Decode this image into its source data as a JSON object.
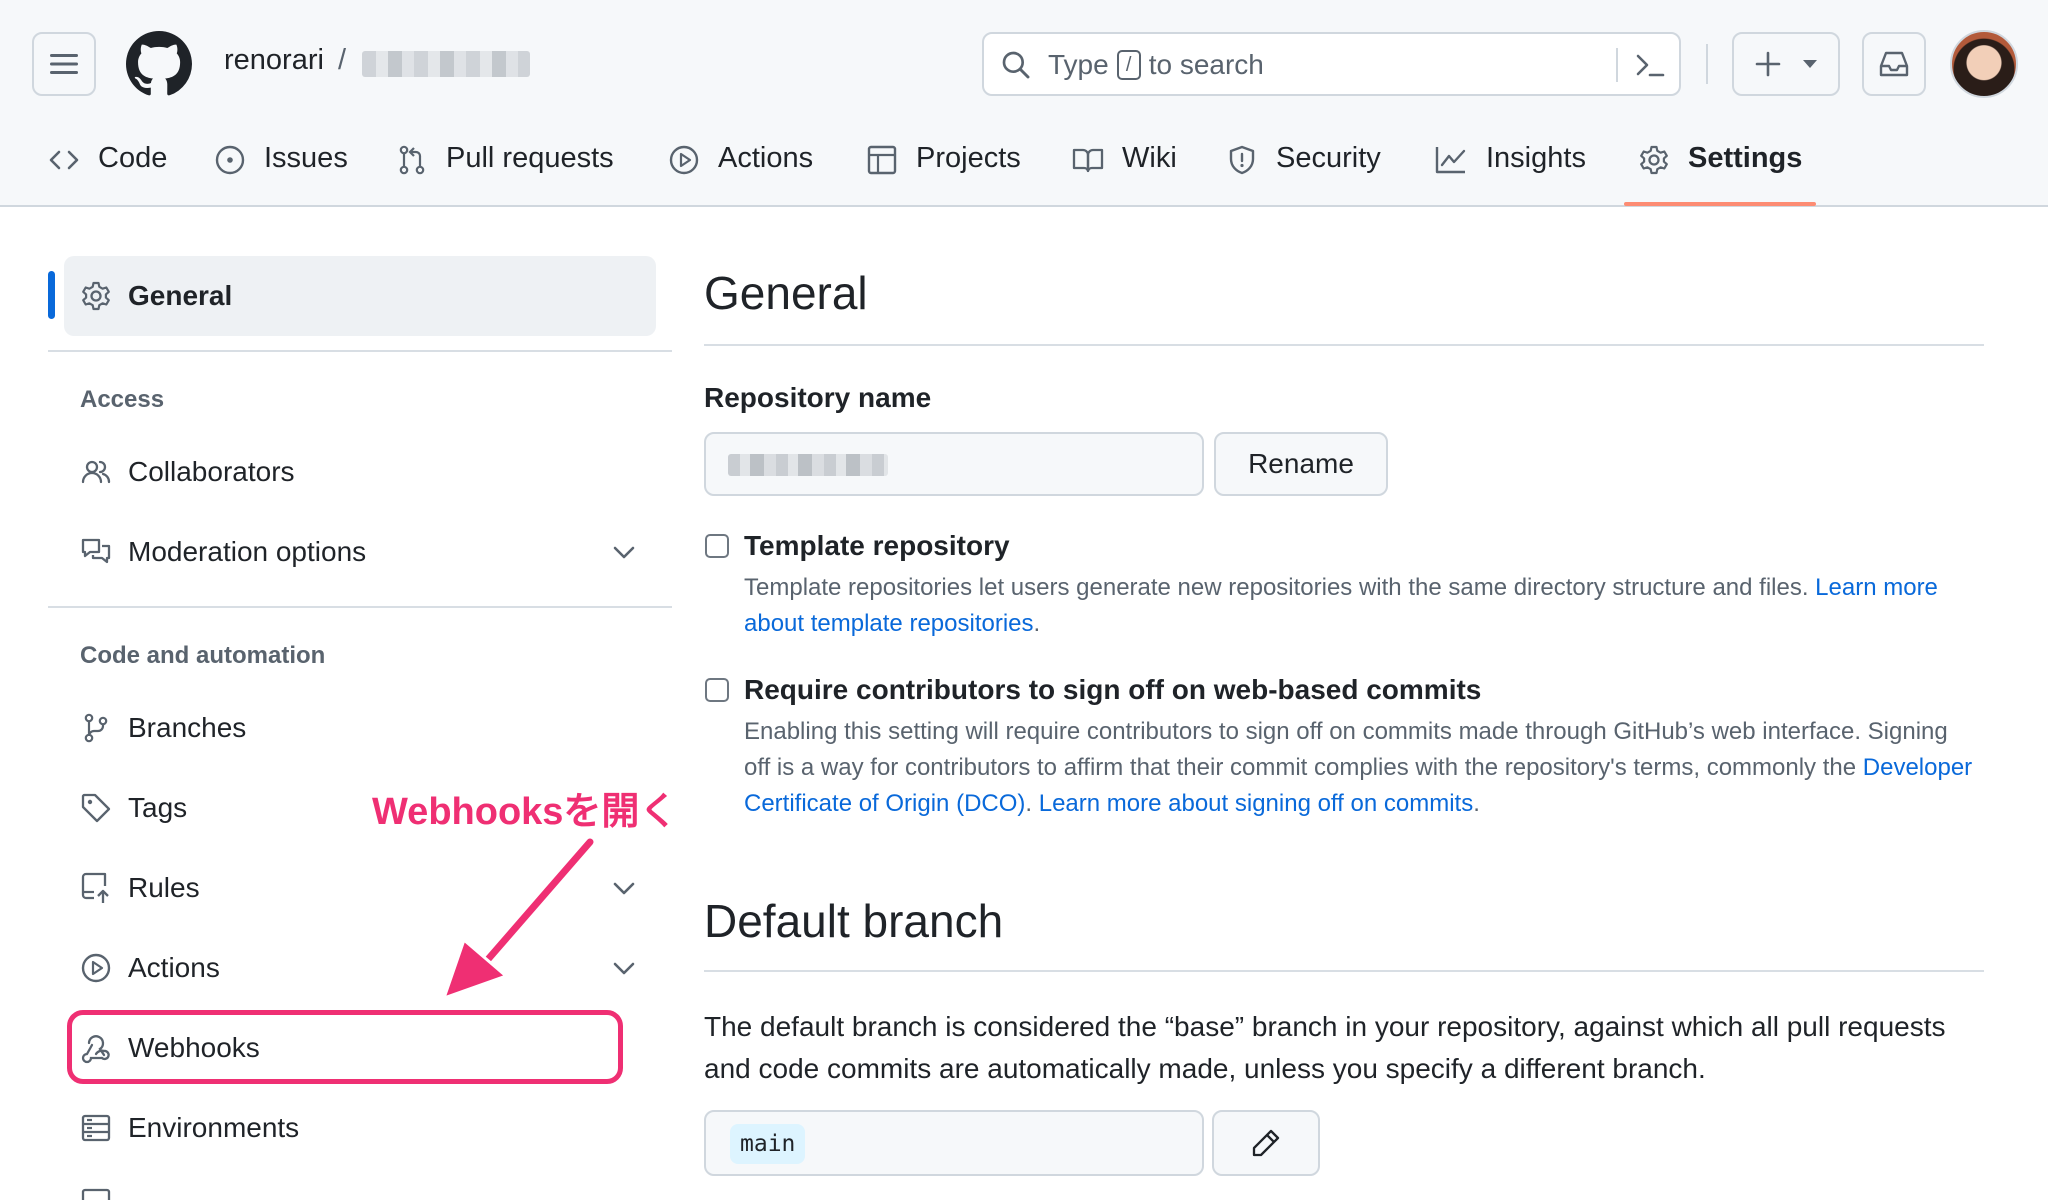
{
  "header": {
    "owner": "renorari",
    "separator": "/",
    "search": {
      "prefix": "Type",
      "key": "/",
      "suffix": "to search"
    }
  },
  "tabs": [
    {
      "label": "Code",
      "icon": "code-icon"
    },
    {
      "label": "Issues",
      "icon": "issue-opened-icon"
    },
    {
      "label": "Pull requests",
      "icon": "git-pull-request-icon"
    },
    {
      "label": "Actions",
      "icon": "play-icon"
    },
    {
      "label": "Projects",
      "icon": "table-icon"
    },
    {
      "label": "Wiki",
      "icon": "book-icon"
    },
    {
      "label": "Security",
      "icon": "shield-icon"
    },
    {
      "label": "Insights",
      "icon": "graph-icon"
    },
    {
      "label": "Settings",
      "icon": "gear-icon",
      "active": true
    }
  ],
  "sidebar": {
    "general": "General",
    "access_heading": "Access",
    "access_items": [
      "Collaborators",
      "Moderation options"
    ],
    "code_heading": "Code and automation",
    "code_items": [
      "Branches",
      "Tags",
      "Rules",
      "Actions",
      "Webhooks",
      "Environments"
    ]
  },
  "annotation": {
    "text": "Webhooksを開く",
    "color": "#ef2f73"
  },
  "main": {
    "title": "General",
    "repo_name_label": "Repository name",
    "rename_button": "Rename",
    "template": {
      "title": "Template repository",
      "desc": "Template repositories let users generate new repositories with the same directory structure and files. ",
      "link": "Learn more about template repositories",
      "end": "."
    },
    "signoff": {
      "title": "Require contributors to sign off on web-based commits",
      "desc": "Enabling this setting will require contributors to sign off on commits made through GitHub’s web interface. Signing off is a way for contributors to affirm that their commit complies with the repository's terms, commonly the ",
      "link1": "Developer Certificate of Origin (DCO)",
      "mid": ". ",
      "link2": "Learn more about signing off on commits",
      "end": "."
    },
    "default_branch_title": "Default branch",
    "default_branch_desc": "The default branch is considered the “base” branch in your repository, against which all pull requests and code commits are automatically made, unless you specify a different branch.",
    "branch_value": "main"
  },
  "colors": {
    "accent": "#0969da",
    "tab_underline": "#fd8c73",
    "link": "#0969da"
  }
}
